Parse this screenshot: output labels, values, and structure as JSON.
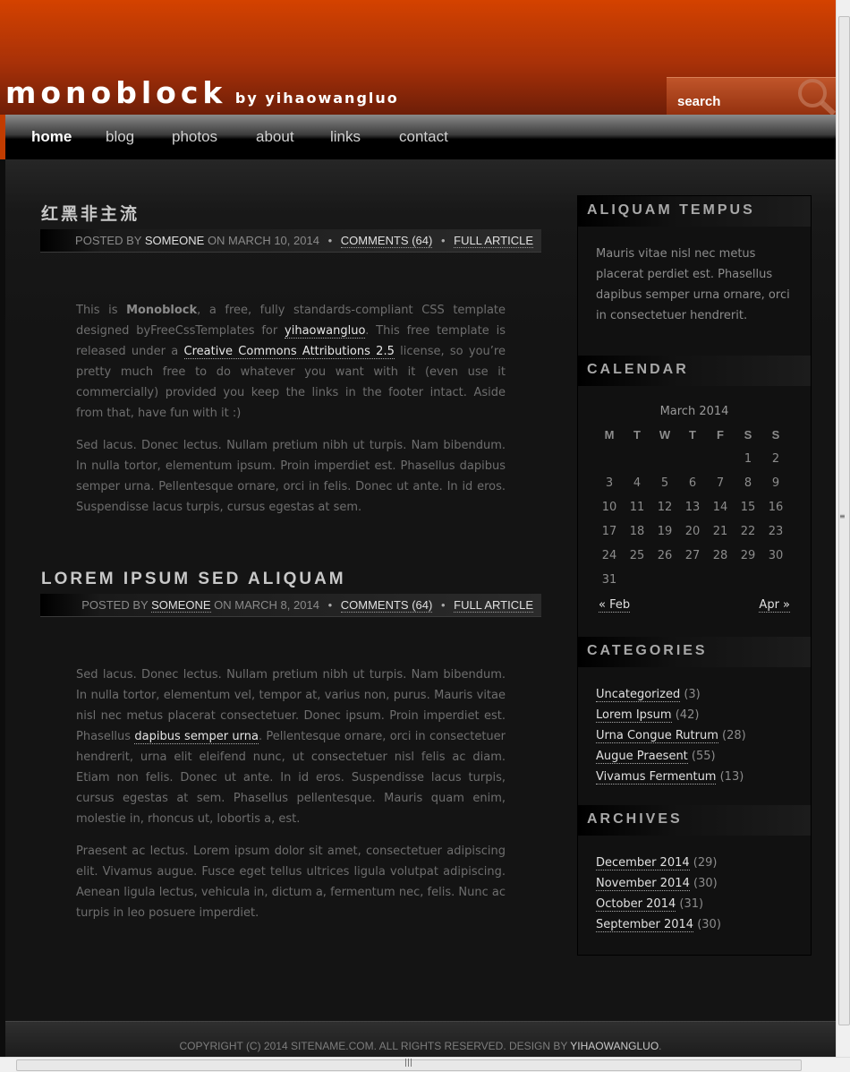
{
  "site": {
    "name": "monoblock",
    "byline": "by yihaowangluo"
  },
  "search": {
    "label": "search"
  },
  "nav": [
    "home",
    "blog",
    "photos",
    "about",
    "links",
    "contact"
  ],
  "posts": [
    {
      "title": "红黑非主流",
      "meta": {
        "posted_by": "POSTED BY",
        "author": "SOMEONE",
        "on": "ON MARCH 10, 2014",
        "comments": "COMMENTS (64)",
        "full": "FULL ARTICLE"
      },
      "p1": {
        "a": "This is ",
        "b": "Monoblock",
        "c": ", a free, fully standards-compliant CSS template designed byFreeCssTemplates for ",
        "link1": "yihaowangluo",
        "d": ". This free template is released under a ",
        "link2": "Creative Commons Attributions 2.5",
        "e": " license, so you’re pretty much free to do whatever you want with it (even use it commercially) provided you keep the links in the footer intact. Aside from that, have fun with it :)"
      },
      "p2": "Sed lacus. Donec lectus. Nullam pretium nibh ut turpis. Nam bibendum. In nulla tortor, elementum ipsum. Proin imperdiet est. Phasellus dapibus semper urna. Pellentesque ornare, orci in felis. Donec ut ante. In id eros. Suspendisse lacus turpis, cursus egestas at sem."
    },
    {
      "title": "LOREM IPSUM SED ALIQUAM",
      "meta": {
        "posted_by": "POSTED BY",
        "author": "SOMEONE",
        "on": "ON MARCH 8, 2014",
        "comments": "COMMENTS (64)",
        "full": "FULL ARTICLE"
      },
      "p1": {
        "a": "Sed lacus. Donec lectus. Nullam pretium nibh ut turpis. Nam bibendum. In nulla tortor, elementum vel, tempor at, varius non, purus. Mauris vitae nisl nec metus placerat consectetuer. Donec ipsum. Proin imperdiet est. Phasellus ",
        "link1": "dapibus semper urna",
        "b": ". Pellentesque ornare, orci in consectetuer hendrerit, urna elit eleifend nunc, ut consectetuer nisl felis ac diam. Etiam non felis. Donec ut ante. In id eros. Suspendisse lacus turpis, cursus egestas at sem. Phasellus pellentesque. Mauris quam enim, molestie in, rhoncus ut, lobortis a, est."
      },
      "p2": "Praesent ac lectus. Lorem ipsum dolor sit amet, consectetuer adipiscing elit. Vivamus augue. Fusce eget tellus ultrices ligula volutpat adipiscing. Aenean ligula lectus, vehicula in, dictum a, fermentum nec, felis. Nunc ac turpis in leo posuere imperdiet."
    }
  ],
  "sidebar": {
    "about": {
      "title": "ALIQUAM TEMPUS",
      "text": "Mauris vitae nisl nec metus placerat perdiet est. Phasellus dapibus semper urna ornare, orci in consectetuer hendrerit."
    },
    "calendar": {
      "title": "CALENDAR",
      "caption": "March 2014",
      "days": [
        "M",
        "T",
        "W",
        "T",
        "F",
        "S",
        "S"
      ],
      "first_weekday": 5,
      "num_days": 31,
      "prev": "« Feb",
      "next": "Apr »"
    },
    "categories": {
      "title": "CATEGORIES",
      "items": [
        {
          "name": "Uncategorized",
          "count": "(3)"
        },
        {
          "name": "Lorem Ipsum",
          "count": "(42)"
        },
        {
          "name": "Urna Congue Rutrum",
          "count": "(28)"
        },
        {
          "name": "Augue Praesent",
          "count": "(55)"
        },
        {
          "name": "Vivamus Fermentum",
          "count": "(13)"
        }
      ]
    },
    "archives": {
      "title": "ARCHIVES",
      "items": [
        {
          "name": "December 2014",
          "count": "(29)"
        },
        {
          "name": "November 2014",
          "count": "(30)"
        },
        {
          "name": "October 2014",
          "count": "(31)"
        },
        {
          "name": "September 2014",
          "count": "(30)"
        }
      ]
    }
  },
  "footer": {
    "text": "COPYRIGHT (C) 2014 SITENAME.COM. ALL RIGHTS RESERVED. DESIGN BY ",
    "link": "YIHAOWANGLUO",
    "end": "."
  }
}
